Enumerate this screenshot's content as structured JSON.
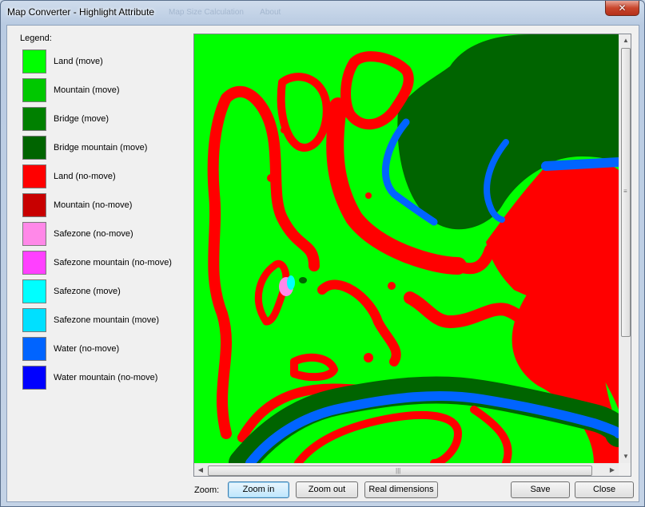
{
  "window": {
    "title": "Map Converter - Highlight Attribute",
    "background_menu": [
      "Map Size Calculation",
      "About"
    ],
    "close_glyph": "✕"
  },
  "legend": {
    "title": "Legend:",
    "items": [
      {
        "label": "Land (move)",
        "color": "#00ff00"
      },
      {
        "label": "Mountain (move)",
        "color": "#00c800"
      },
      {
        "label": "Bridge (move)",
        "color": "#008000"
      },
      {
        "label": "Bridge mountain (move)",
        "color": "#006400"
      },
      {
        "label": "Land (no-move)",
        "color": "#ff0000"
      },
      {
        "label": "Mountain (no-move)",
        "color": "#c80000"
      },
      {
        "label": "Safezone (no-move)",
        "color": "#ff88e8"
      },
      {
        "label": "Safezone mountain (no-move)",
        "color": "#ff40ff"
      },
      {
        "label": "Safezone (move)",
        "color": "#00ffff"
      },
      {
        "label": "Safezone mountain (move)",
        "color": "#00e0ff"
      },
      {
        "label": "Water (no-move)",
        "color": "#0064ff"
      },
      {
        "label": "Water mountain (no-move)",
        "color": "#0000ff"
      }
    ]
  },
  "map": {
    "colors": {
      "land": "#00ff00",
      "no_move": "#ff0000",
      "bridge": "#006400",
      "water": "#0064ff",
      "safezone": "#ff88e8",
      "safezone_move": "#00ffff"
    }
  },
  "scrollbars": {
    "up": "▲",
    "down": "▼",
    "left": "◀",
    "right": "▶",
    "grip_v": "≡",
    "grip_h": "|||"
  },
  "toolbar": {
    "zoom_label": "Zoom:",
    "zoom_in": "Zoom in",
    "zoom_out": "Zoom out",
    "real_dimensions": "Real dimensions",
    "save": "Save",
    "close": "Close"
  }
}
